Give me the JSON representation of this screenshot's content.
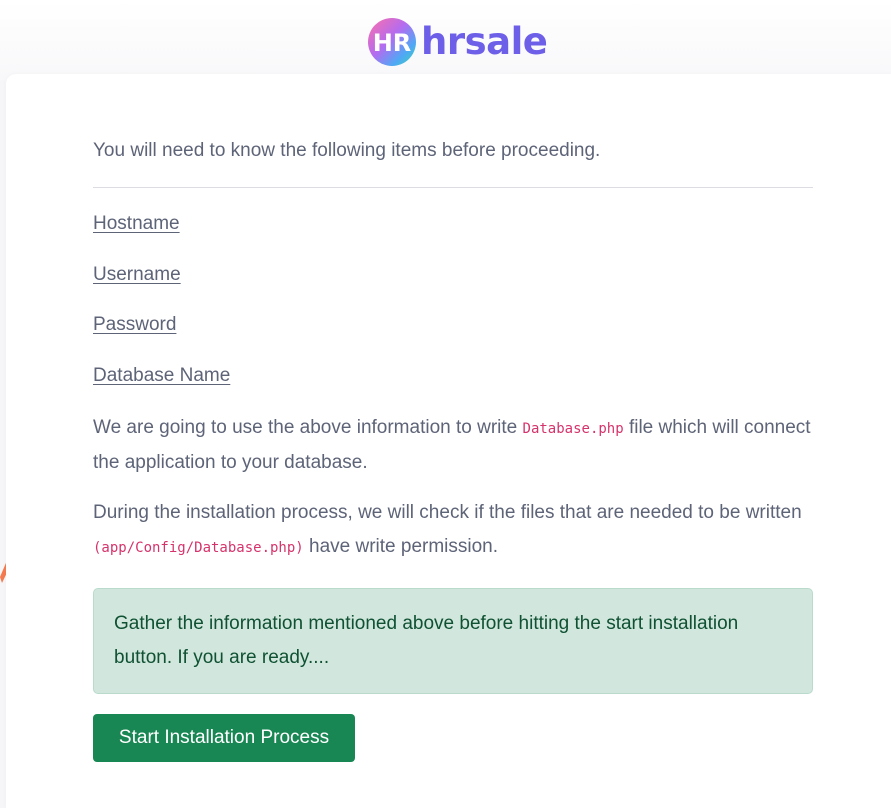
{
  "brand": {
    "mark_letters": "HR",
    "name": "hrsale"
  },
  "intro": "You will need to know the following items before proceeding.",
  "requirements": [
    "Hostname",
    "Username",
    "Password",
    "Database Name"
  ],
  "paragraph1": {
    "before": "We are going to use the above information to write ",
    "code": "Database.php",
    "after": " file which will connect the application to your database."
  },
  "paragraph2": {
    "before": "During the installation process, we will check if the files that are needed to be written ",
    "code": "(app/Config/Database.php)",
    "after": " have write permission."
  },
  "alert": "Gather the information mentioned above before hitting the start installation button. If you are ready....",
  "start_button": "Start Installation Process",
  "colors": {
    "brand": "#6d5fe8",
    "alert_bg": "#d1e7dd",
    "alert_text": "#0f5132",
    "button": "#198754",
    "code": "#d6336c"
  }
}
